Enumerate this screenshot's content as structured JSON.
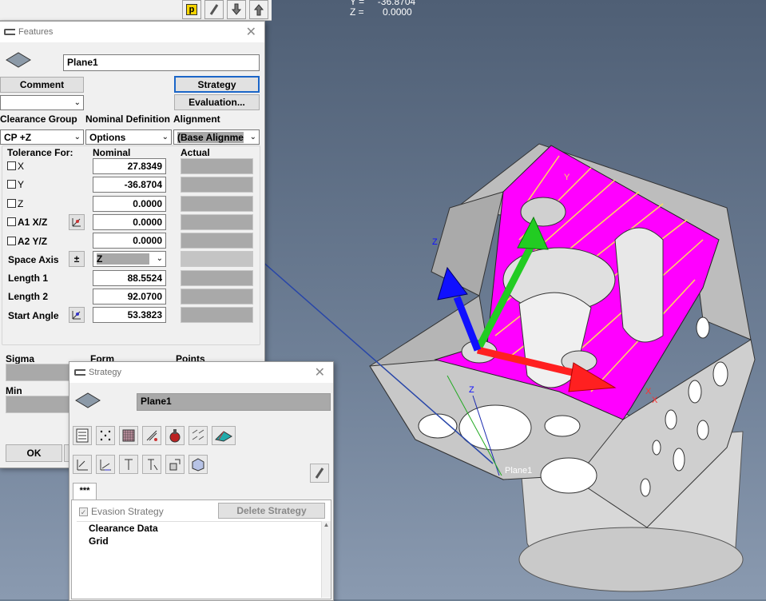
{
  "readout": {
    "y": "Y =     -36.8704",
    "z": "Z =       0.0000"
  },
  "features": {
    "title": "Features",
    "name_value": "Plane1",
    "comment_label": "Comment",
    "strategy_label": "Strategy",
    "evaluation_label": "Evaluation...",
    "clearance_group_label": "Clearance Group",
    "nominal_definition_label": "Nominal Definition",
    "alignment_label": "Alignment",
    "clearance_value": "CP +Z",
    "nominal_def_value": "Options",
    "alignment_value": "(Base Alignme",
    "tolerance_for_label": "Tolerance For:",
    "nominal_col_label": "Nominal",
    "actual_col_label": "Actual",
    "rows": [
      {
        "label": "X",
        "value": "27.8349"
      },
      {
        "label": "Y",
        "value": "-36.8704"
      },
      {
        "label": "Z",
        "value": "0.0000"
      },
      {
        "label": "A1 X/Z",
        "value": "0.0000"
      },
      {
        "label": "A2 Y/Z",
        "value": "0.0000"
      }
    ],
    "space_axis_label": "Space Axis",
    "space_axis_value": "Z",
    "pm_label": "±",
    "length1_label": "Length 1",
    "length1_value": "88.5524",
    "length2_label": "Length 2",
    "length2_value": "92.0700",
    "start_angle_label": "Start Angle",
    "start_angle_value": "53.3823",
    "sigma_label": "Sigma",
    "form_label": "Form",
    "points_label": "Points",
    "min_label": "Min",
    "ok_label": "OK"
  },
  "strategy": {
    "title": "Strategy",
    "name_value": "Plane1",
    "tab_label": "***",
    "evasion_label": "Evasion Strategy",
    "delete_label": "Delete Strategy",
    "tree_items": [
      "Clearance Data",
      "Grid"
    ]
  },
  "scene": {
    "plane_label": "Plane1",
    "axis_y": "Y",
    "axis_z": "Z",
    "axis_x": "X",
    "colors": {
      "face": "#ff00ff",
      "x_arrow": "#ff2020",
      "y_arrow": "#22cc22",
      "z_arrow": "#1010ff",
      "highlight": "#2846a8"
    }
  },
  "toolbar": {
    "p_label": "p"
  }
}
